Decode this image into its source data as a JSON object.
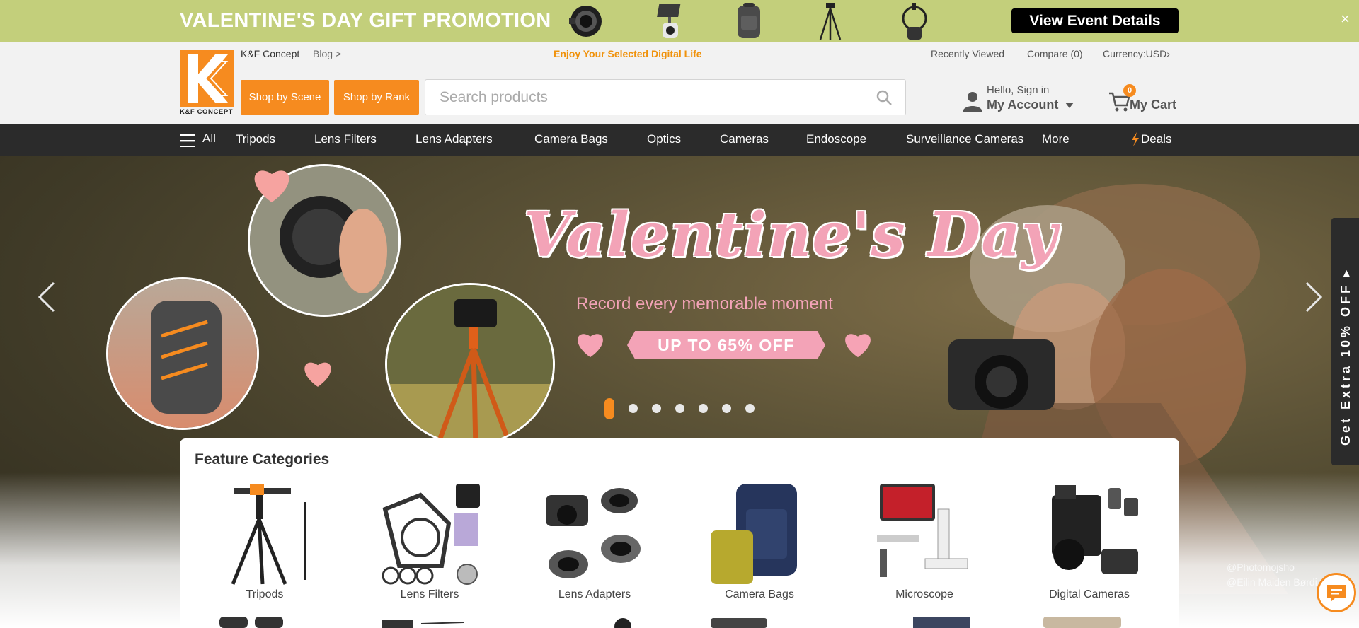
{
  "promo": {
    "title": "VALENTINE'S DAY GIFT PROMOTION",
    "button": "View Event Details",
    "close": "×",
    "products": [
      "lens-adapter-icon",
      "surveillance-camera-icon",
      "backpack-icon",
      "tripod-icon",
      "endoscope-icon"
    ]
  },
  "header": {
    "brand_link": "K&F Concept",
    "blog_link": "Blog >",
    "tagline": "Enjoy Your Selected Digital Life",
    "recently_viewed": "Recently Viewed",
    "compare": "Compare (0)",
    "currency": "Currency:USD›",
    "logo_text": "K&F CONCEPT",
    "shop_by_scene": "Shop by Scene",
    "shop_by_rank": "Shop by Rank",
    "search_placeholder": "Search products",
    "hello": "Hello, Sign in",
    "my_account": "My Account",
    "cart_label": "My Cart",
    "cart_count": "0",
    "accent_color": "#f68b1f"
  },
  "nav": {
    "all": "All",
    "items": [
      "Tripods",
      "Lens Filters",
      "Lens Adapters",
      "Camera Bags",
      "Optics",
      "Cameras",
      "Endoscope",
      "Surveillance Cameras",
      "More"
    ],
    "deals": "Deals"
  },
  "hero": {
    "title": "Valentine's Day",
    "subtitle": "Record every memorable moment",
    "badge": "UP TO 65% OFF",
    "credit_1": "@Photomojsho",
    "credit_2": "@Eilin Maiden Børdi",
    "side_tab": "Get Extra 10% OFF ▸",
    "slides": 7,
    "active_slide": 1
  },
  "features": {
    "title": "Feature Categories",
    "categories": [
      "Tripods",
      "Lens Filters",
      "Lens Adapters",
      "Camera Bags",
      "Microscope",
      "Digital Cameras"
    ]
  }
}
